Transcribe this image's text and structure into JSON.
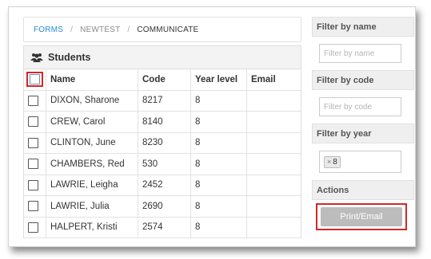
{
  "breadcrumb": {
    "item1": "FORMS",
    "sep1": "/",
    "item2": "NEWTEST",
    "sep2": "/",
    "item3": "COMMUNICATE"
  },
  "panel": {
    "title": "Students",
    "columns": {
      "name": "Name",
      "code": "Code",
      "year": "Year level",
      "email": "Email"
    },
    "rows": [
      {
        "name": "DIXON, Sharone",
        "code": "8217",
        "year": "8",
        "email": ""
      },
      {
        "name": "CREW, Carol",
        "code": "8140",
        "year": "8",
        "email": ""
      },
      {
        "name": "CLINTON, June",
        "code": "8230",
        "year": "8",
        "email": ""
      },
      {
        "name": "CHAMBERS, Red",
        "code": "530",
        "year": "8",
        "email": ""
      },
      {
        "name": "LAWRIE, Leigha",
        "code": "2452",
        "year": "8",
        "email": ""
      },
      {
        "name": "LAWRIE, Julia",
        "code": "2690",
        "year": "8",
        "email": ""
      },
      {
        "name": "HALPERT, Kristi",
        "code": "2574",
        "year": "8",
        "email": ""
      }
    ]
  },
  "sidebar": {
    "filter_name": {
      "heading": "Filter by name",
      "placeholder": "Filter by name"
    },
    "filter_code": {
      "heading": "Filter by code",
      "placeholder": "Filter by code"
    },
    "filter_year": {
      "heading": "Filter by year",
      "tag_x": "×",
      "tag_value": "8"
    },
    "actions": {
      "heading": "Actions",
      "button": "Print/Email"
    }
  },
  "colors": {
    "link": "#2a8bd0",
    "highlight": "#d42727",
    "button_disabled": "#bcbcbc"
  },
  "icons": {
    "students": "users-icon"
  }
}
